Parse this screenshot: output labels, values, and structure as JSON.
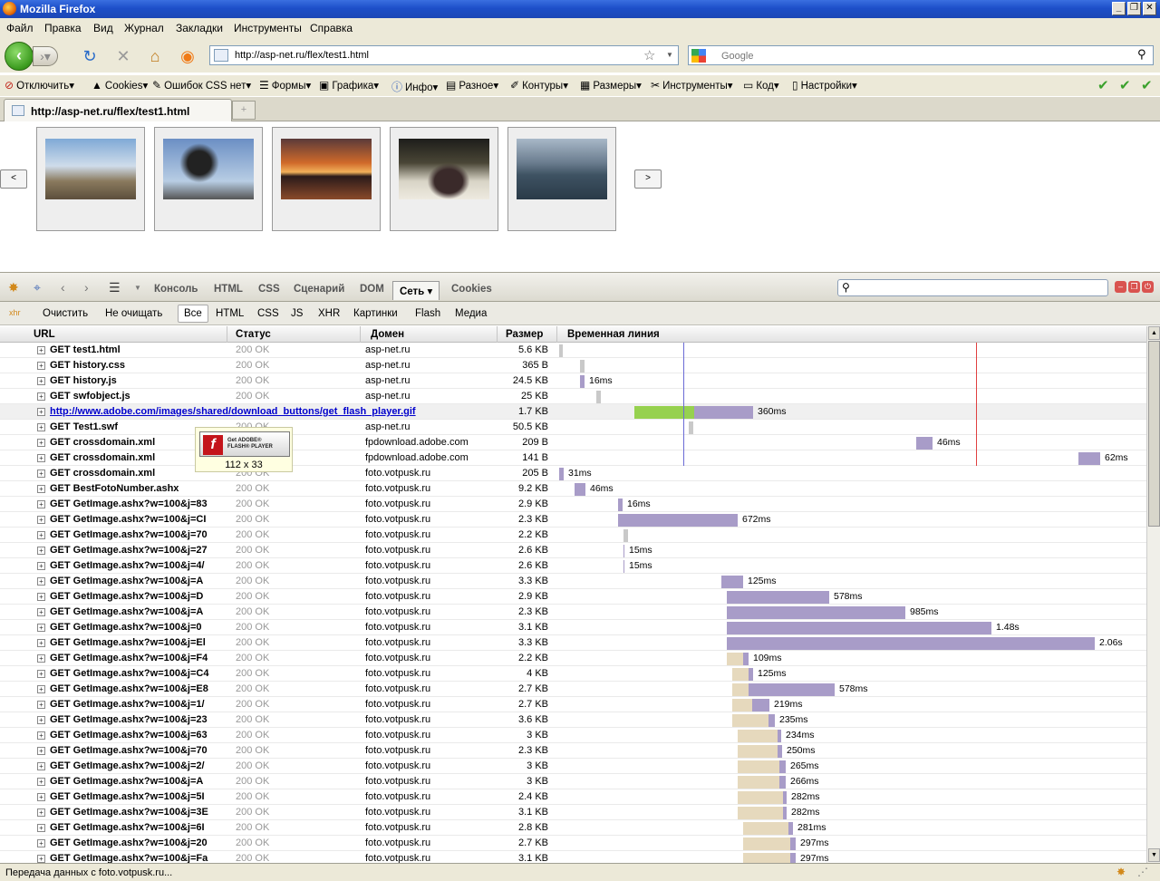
{
  "window": {
    "title": "Mozilla Firefox",
    "controls": [
      "minimize-icon",
      "restore-icon",
      "close-icon"
    ]
  },
  "menu": [
    "Файл",
    "Правка",
    "Вид",
    "Журнал",
    "Закладки",
    "Инструменты",
    "Справка"
  ],
  "nav": {
    "url": "http://asp-net.ru/flex/test1.html",
    "search_placeholder": "Google"
  },
  "webdev": {
    "items": [
      "Отключить",
      "Cookies",
      "Ошибок CSS нет",
      "Формы",
      "Графика",
      "Инфо",
      "Разное",
      "Контуры",
      "Размеры",
      "Инструменты",
      "Код",
      "Настройки"
    ]
  },
  "tab": {
    "title": "http://asp-net.ru/flex/test1.html"
  },
  "gallery": {
    "prev": "<",
    "next": ">"
  },
  "firebug": {
    "tabs": [
      "Консоль",
      "HTML",
      "CSS",
      "Сценарий",
      "DOM",
      "Сеть",
      "Cookies"
    ],
    "active_tab": "Сеть",
    "filters": [
      "Очистить",
      "Не очищать",
      "Все",
      "HTML",
      "CSS",
      "JS",
      "XHR",
      "Картинки",
      "Flash",
      "Медиа"
    ],
    "active_filter": "Все",
    "columns": {
      "url": "URL",
      "status": "Статус",
      "domain": "Домен",
      "size": "Размер",
      "timeline": "Временная линия"
    }
  },
  "requests": [
    {
      "url": "GET test1.html",
      "status": "200 OK",
      "domain": "asp-net.ru",
      "size": "5.6 KB",
      "time": ""
    },
    {
      "url": "GET history.css",
      "status": "200 OK",
      "domain": "asp-net.ru",
      "size": "365 B",
      "time": ""
    },
    {
      "url": "GET history.js",
      "status": "200 OK",
      "domain": "asp-net.ru",
      "size": "24.5 KB",
      "time": "16ms"
    },
    {
      "url": "GET swfobject.js",
      "status": "200 OK",
      "domain": "asp-net.ru",
      "size": "25 KB",
      "time": ""
    },
    {
      "url": "http://www.adobe.com/images/shared/download_buttons/get_flash_player.gif",
      "status": "",
      "domain": "",
      "size": "1.7 KB",
      "time": "360ms"
    },
    {
      "url": "GET Test1.swf",
      "status": "200 OK",
      "domain": "asp-net.ru",
      "size": "50.5 KB",
      "time": ""
    },
    {
      "url": "GET crossdomain.xml",
      "status": "200 OK",
      "domain": "fpdownload.adobe.com",
      "size": "209 B",
      "time": "46ms"
    },
    {
      "url": "GET crossdomain.xml",
      "status": "200 OK",
      "domain": "fpdownload.adobe.com",
      "size": "141 B",
      "time": "62ms"
    },
    {
      "url": "GET crossdomain.xml",
      "status": "200 OK",
      "domain": "foto.votpusk.ru",
      "size": "205 B",
      "time": "31ms"
    },
    {
      "url": "GET BestFotoNumber.ashx",
      "status": "200 OK",
      "domain": "foto.votpusk.ru",
      "size": "9.2 KB",
      "time": "46ms"
    },
    {
      "url": "GET GetImage.ashx?w=100&j=83",
      "status": "200 OK",
      "domain": "foto.votpusk.ru",
      "size": "2.9 KB",
      "time": "16ms"
    },
    {
      "url": "GET GetImage.ashx?w=100&j=CI",
      "status": "200 OK",
      "domain": "foto.votpusk.ru",
      "size": "2.3 KB",
      "time": "672ms"
    },
    {
      "url": "GET GetImage.ashx?w=100&j=70",
      "status": "200 OK",
      "domain": "foto.votpusk.ru",
      "size": "2.2 KB",
      "time": ""
    },
    {
      "url": "GET GetImage.ashx?w=100&j=27",
      "status": "200 OK",
      "domain": "foto.votpusk.ru",
      "size": "2.6 KB",
      "time": "15ms"
    },
    {
      "url": "GET GetImage.ashx?w=100&j=4/",
      "status": "200 OK",
      "domain": "foto.votpusk.ru",
      "size": "2.6 KB",
      "time": "15ms"
    },
    {
      "url": "GET GetImage.ashx?w=100&j=A",
      "status": "200 OK",
      "domain": "foto.votpusk.ru",
      "size": "3.3 KB",
      "time": "125ms"
    },
    {
      "url": "GET GetImage.ashx?w=100&j=D",
      "status": "200 OK",
      "domain": "foto.votpusk.ru",
      "size": "2.9 KB",
      "time": "578ms"
    },
    {
      "url": "GET GetImage.ashx?w=100&j=A",
      "status": "200 OK",
      "domain": "foto.votpusk.ru",
      "size": "2.3 KB",
      "time": "985ms"
    },
    {
      "url": "GET GetImage.ashx?w=100&j=0",
      "status": "200 OK",
      "domain": "foto.votpusk.ru",
      "size": "3.1 KB",
      "time": "1.48s"
    },
    {
      "url": "GET GetImage.ashx?w=100&j=El",
      "status": "200 OK",
      "domain": "foto.votpusk.ru",
      "size": "3.3 KB",
      "time": "2.06s"
    },
    {
      "url": "GET GetImage.ashx?w=100&j=F4",
      "status": "200 OK",
      "domain": "foto.votpusk.ru",
      "size": "2.2 KB",
      "time": "109ms"
    },
    {
      "url": "GET GetImage.ashx?w=100&j=C4",
      "status": "200 OK",
      "domain": "foto.votpusk.ru",
      "size": "4 KB",
      "time": "125ms"
    },
    {
      "url": "GET GetImage.ashx?w=100&j=E8",
      "status": "200 OK",
      "domain": "foto.votpusk.ru",
      "size": "2.7 KB",
      "time": "578ms"
    },
    {
      "url": "GET GetImage.ashx?w=100&j=1/",
      "status": "200 OK",
      "domain": "foto.votpusk.ru",
      "size": "2.7 KB",
      "time": "219ms"
    },
    {
      "url": "GET GetImage.ashx?w=100&j=23",
      "status": "200 OK",
      "domain": "foto.votpusk.ru",
      "size": "3.6 KB",
      "time": "235ms"
    },
    {
      "url": "GET GetImage.ashx?w=100&j=63",
      "status": "200 OK",
      "domain": "foto.votpusk.ru",
      "size": "3 KB",
      "time": "234ms"
    },
    {
      "url": "GET GetImage.ashx?w=100&j=70",
      "status": "200 OK",
      "domain": "foto.votpusk.ru",
      "size": "2.3 KB",
      "time": "250ms"
    },
    {
      "url": "GET GetImage.ashx?w=100&j=2/",
      "status": "200 OK",
      "domain": "foto.votpusk.ru",
      "size": "3 KB",
      "time": "265ms"
    },
    {
      "url": "GET GetImage.ashx?w=100&j=A",
      "status": "200 OK",
      "domain": "foto.votpusk.ru",
      "size": "3 KB",
      "time": "266ms"
    },
    {
      "url": "GET GetImage.ashx?w=100&j=5I",
      "status": "200 OK",
      "domain": "foto.votpusk.ru",
      "size": "2.4 KB",
      "time": "282ms"
    },
    {
      "url": "GET GetImage.ashx?w=100&j=3E",
      "status": "200 OK",
      "domain": "foto.votpusk.ru",
      "size": "3.1 KB",
      "time": "282ms"
    },
    {
      "url": "GET GetImage.ashx?w=100&j=6I",
      "status": "200 OK",
      "domain": "foto.votpusk.ru",
      "size": "2.8 KB",
      "time": "281ms"
    },
    {
      "url": "GET GetImage.ashx?w=100&j=20",
      "status": "200 OK",
      "domain": "foto.votpusk.ru",
      "size": "2.7 KB",
      "time": "297ms"
    },
    {
      "url": "GET GetImage.ashx?w=100&j=Fa",
      "status": "200 OK",
      "domain": "foto.votpusk.ru",
      "size": "3.1 KB",
      "time": "297ms"
    }
  ],
  "tooltip": {
    "flash_line1": "Get ADOBE®",
    "flash_line2": "FLASH® PLAYER",
    "dimensions": "112 x 33"
  },
  "status": {
    "text": "Передача данных с foto.votpusk.ru..."
  },
  "colors": {
    "titlebar": "#1d4fc9",
    "chrome": "#ece9d8",
    "bar_wait": "#a89cc8",
    "bar_dns": "#e6d9bd",
    "bar_green": "#96d14f"
  }
}
